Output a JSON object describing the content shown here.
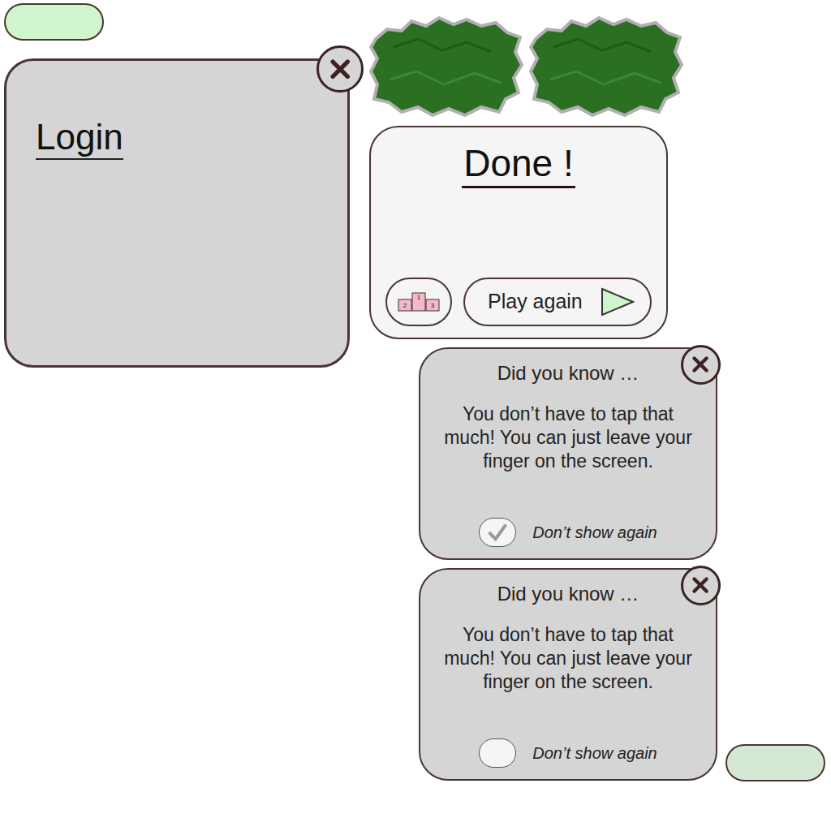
{
  "pills": [
    {
      "color": "#d0f5cc"
    },
    {
      "color": "#d5e8d4"
    }
  ],
  "login_panel": {
    "title": "Login"
  },
  "done_panel": {
    "title": "Done !",
    "podium_ranks": [
      "2",
      "1",
      "3"
    ],
    "play_again": "Play again"
  },
  "tips": [
    {
      "heading": "Did you know …",
      "body": "You don’t have to tap that much! You can just leave your finger on the screen.",
      "checkbox_label": "Don’t show again",
      "checked": true
    },
    {
      "heading": "Did you know …",
      "body": "You don’t have to tap that much! You can just leave your finger on the screen.",
      "checkbox_label": "Don’t show again",
      "checked": false
    }
  ]
}
